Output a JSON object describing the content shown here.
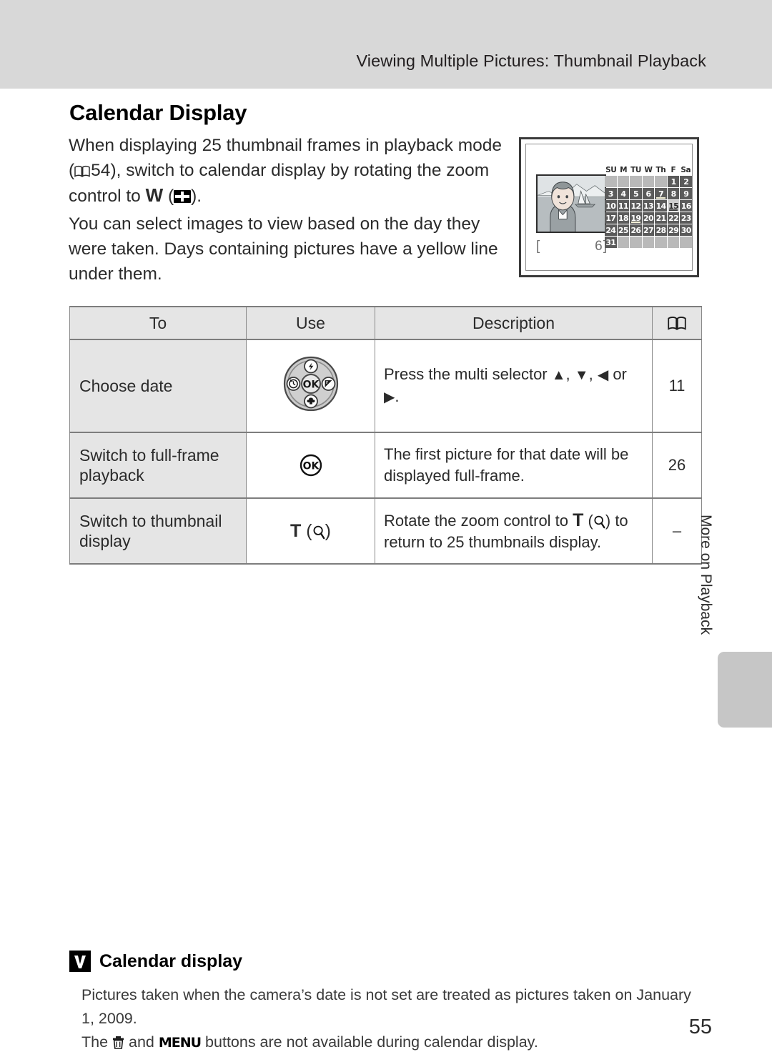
{
  "header": {
    "running_title": "Viewing Multiple Pictures: Thumbnail Playback"
  },
  "page_title": "Calendar Display",
  "intro": {
    "para1_a": "When displaying 25 thumbnail frames in playback mode (",
    "para1_ref": "54",
    "para1_b": "), switch to calendar display by rotating the zoom control to ",
    "para1_w": "W",
    "para1_c": ").",
    "para2": "You can select images to view based on the day they were taken. Days containing pictures have a yellow line under them."
  },
  "lcd": {
    "picture_count_open": "[",
    "picture_count": "6]",
    "weekdays": [
      "SU",
      "M",
      "TU",
      "W",
      "Th",
      "F",
      "Sa"
    ],
    "blank_leading": 5,
    "days": [
      1,
      2,
      3,
      4,
      5,
      6,
      7,
      8,
      9,
      10,
      11,
      12,
      13,
      14,
      15,
      16,
      17,
      18,
      19,
      20,
      21,
      22,
      23,
      24,
      25,
      26,
      27,
      28,
      29,
      30,
      31
    ],
    "selected_day": 15,
    "days_with_pictures": [
      7,
      15,
      19
    ],
    "trailing_blanks": 6,
    "colors": {
      "day_cell": "#5b5b5b",
      "empty_cell": "#b9b9b9",
      "selected_cell": "#cfcfcf",
      "picture_line": "#f2efd6"
    }
  },
  "table": {
    "headers": {
      "to": "To",
      "use": "Use",
      "description": "Description",
      "page": "book-icon"
    },
    "rows": [
      {
        "to": "Choose date",
        "use_icon": "multi-selector-icon",
        "desc_a": "Press the multi selector ",
        "desc_b": ", ",
        "desc_c": ", ",
        "desc_d": " or ",
        "desc_e": ".",
        "page": "11"
      },
      {
        "to": "Switch to full-frame playback",
        "use_icon": "ok-button-icon",
        "desc": "The first picture for that date will be displayed full-frame.",
        "page": "26"
      },
      {
        "to": "Switch to thumbnail display",
        "use_icon": "tele-zoom-icon",
        "use_label": "T",
        "desc_a": "Rotate the zoom control to ",
        "desc_t": "T",
        "desc_b": ") to return to 25 thumbnails display.",
        "page": "–"
      }
    ]
  },
  "side_tab": {
    "label": "More on Playback"
  },
  "note": {
    "title": "Calendar display",
    "line1": "Pictures taken when the camera’s date is not set are treated as pictures taken on January 1, 2009.",
    "line2_a": "The ",
    "line2_menu": "MENU",
    "line2_b": " buttons are not available during calendar display.",
    "line2_and": " and "
  },
  "footer": {
    "page_number": "55"
  }
}
